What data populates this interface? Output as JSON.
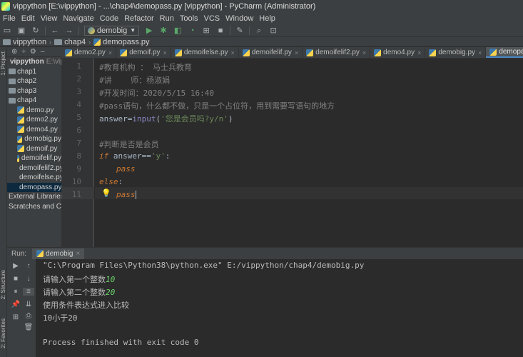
{
  "window": {
    "title": "vippython [E:\\vippython] - ...\\chap4\\demopass.py [vippython] - PyCharm (Administrator)"
  },
  "menu": [
    "File",
    "Edit",
    "View",
    "Navigate",
    "Code",
    "Refactor",
    "Run",
    "Tools",
    "VCS",
    "Window",
    "Help"
  ],
  "toolbar": {
    "run_config": "demobig"
  },
  "breadcrumb": [
    "vippython",
    "chap4",
    "demopass.py"
  ],
  "project": {
    "title": "Project",
    "root": {
      "name": "vippython",
      "path": "E:\\vippython"
    },
    "folders": [
      "chap1",
      "chap2",
      "chap3",
      "chap4"
    ],
    "files": [
      "demo.py",
      "demo2.py",
      "demo4.py",
      "demobig.py",
      "demoif.py",
      "demoifelif.py",
      "demoifelif2.py",
      "demoifelse.py",
      "demopass.py"
    ],
    "extra": [
      "External Libraries",
      "Scratches and Consoles"
    ]
  },
  "tabs": [
    {
      "label": "demo2.py",
      "active": false
    },
    {
      "label": "demoif.py",
      "active": false
    },
    {
      "label": "demoifelse.py",
      "active": false
    },
    {
      "label": "demoifelif.py",
      "active": false
    },
    {
      "label": "demoifelif2.py",
      "active": false
    },
    {
      "label": "demo4.py",
      "active": false
    },
    {
      "label": "demobig.py",
      "active": false
    },
    {
      "label": "demopass.py",
      "active": true
    }
  ],
  "editor": {
    "line_numbers": [
      "1",
      "2",
      "3",
      "4",
      "5",
      "6",
      "7",
      "8",
      "9",
      "10",
      "11"
    ],
    "lines": {
      "l1": "#教育机构 ： 马士兵教育",
      "l2": "#讲    师：杨淑娟",
      "l3": "#开发时间：2020/5/15 16:40",
      "l4": "#pass语句，什么都不做，只是一个占位符，用到需要写语句的地方",
      "l5_var": "answer=",
      "l5_fn": "input",
      "l5_open": "(",
      "l5_str": "'您是会员吗?y/n'",
      "l5_close": ")",
      "l7": "#判断是否是会员",
      "l8_kw": "if",
      "l8_var": " answer==",
      "l8_str": "'y'",
      "l8_colon": ":",
      "l9": "pass",
      "l10_kw": "else",
      "l10_colon": ":",
      "l11": "pass"
    }
  },
  "run": {
    "label": "Run:",
    "tab": "demobig",
    "console": {
      "cmd": "\"C:\\Program Files\\Python38\\python.exe\" E:/vippython/chap4/demobig.py",
      "p1": "请输入第一个整数",
      "v1": "10",
      "p2": "请输入第二个整数",
      "v2": "20",
      "o1": "使用条件表达式进入比较",
      "o2": "10小于20",
      "exit": "Process finished with exit code 0"
    }
  },
  "side_tools": {
    "project": "1: Project",
    "structure": "2: Structure",
    "favorites": "2: Favorites"
  }
}
